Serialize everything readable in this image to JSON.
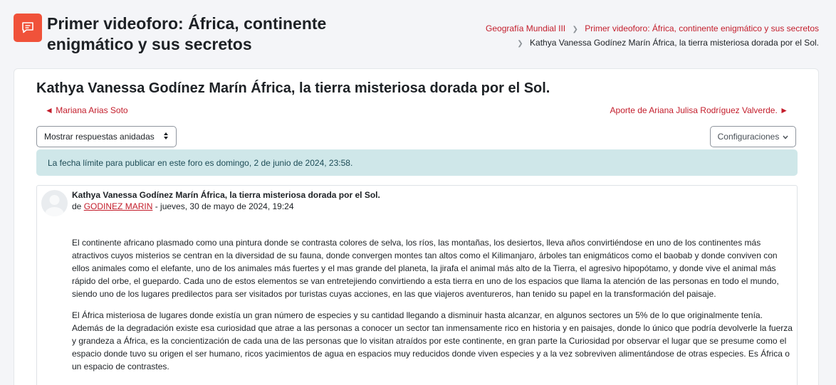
{
  "header": {
    "title": "Primer videoforo: África, continente enigmático y sus secretos",
    "icon": "forum-icon",
    "accent": "#f0523a"
  },
  "breadcrumb": {
    "items": [
      "Geografía Mundial III",
      "Primer videoforo: África, continente enigmático y sus secretos",
      "Kathya Vanessa Godínez Marín África, la tierra misteriosa dorada por el Sol."
    ]
  },
  "discussion": {
    "title": "Kathya Vanessa Godínez Marín África, la tierra misteriosa dorada por el Sol.",
    "prev_link": "◄ Mariana Arias Soto",
    "next_link": "Aporte de Ariana Julisa Rodríguez Valverde. ►",
    "display_mode": "Mostrar respuestas anidadas",
    "settings_label": "Configuraciones",
    "deadline_notice": "La fecha límite para publicar en este foro es domingo, 2 de junio de 2024, 23:58."
  },
  "post": {
    "subject": "Kathya Vanessa Godínez Marín África, la tierra misteriosa dorada por el Sol.",
    "by_prefix": "de",
    "author": "GODINEZ MARIN",
    "date": " - jueves, 30 de mayo de 2024, 19:24",
    "paragraphs": [
      " El continente africano plasmado como una pintura donde se contrasta colores de selva, los ríos, las montañas, los desiertos, lleva años convirtiéndose en uno de los continentes más atractivos cuyos misterios se centran en la diversidad de su fauna, donde convergen montes tan altos como el Kilimanjaro, árboles tan enigmáticos como el baobab y donde conviven con ellos animales como el elefante, uno de los animales más fuertes y el mas grande del  planeta,  la jirafa el animal más alto de la Tierra, el agresivo hipopótamo, y  donde vive el animal más rápido del orbe, el guepardo.  Cada uno de estos elementos se van entretejiendo convirtiendo a esta tierra en uno de los espacios que llama la atención de las personas en todo el mundo, siendo uno de los lugares predilectos para ser visitados por turistas cuyas acciones, en las que viajeros aventureros, han tenido su papel en la transformación del paisaje.",
      "El África misteriosa de lugares donde existía un gran número de especies y su cantidad llegando a disminuir hasta alcanzar, en algunos sectores un 5% de lo que originalmente tenía. Además de la degradación existe esa curiosidad que atrae a las personas a conocer un sector tan inmensamente rico en historia y en paisajes,  donde lo único que podría devolverle la fuerza y grandeza a África, es la concientización de cada una de las personas que lo visitan atraídos por  este continente, en gran parte la Curiosidad por observar el lugar que se presume como el espacio donde tuvo su origen el ser humano, ricos yacimientos de agua en espacios muy reducidos donde viven especies y a  la vez sobreviven alimentándose de otras especies. Es África o un espacio de contrastes."
    ]
  }
}
